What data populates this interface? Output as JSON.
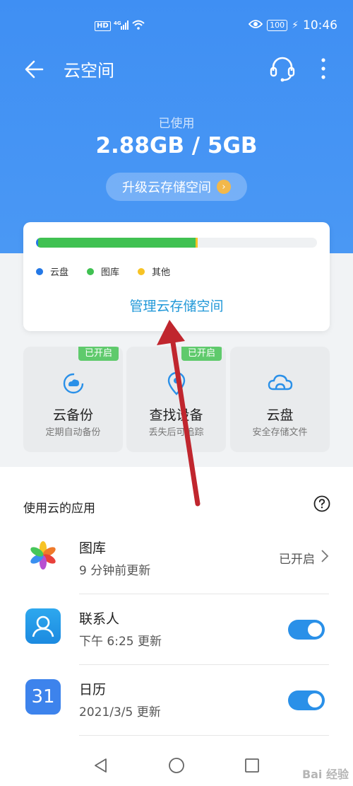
{
  "status_bar": {
    "network": "HD 4G",
    "time": "10:46",
    "battery": "100",
    "icons": [
      "hd-icon",
      "signal-icon",
      "wifi-icon",
      "eye-icon",
      "battery-icon",
      "charging-icon"
    ]
  },
  "header": {
    "title": "云空间",
    "back_icon": "back-arrow-icon",
    "support_icon": "headset-icon",
    "more_icon": "more-vertical-icon"
  },
  "usage": {
    "label": "已使用",
    "value": "2.88GB / 5GB",
    "used_fraction": 0.576,
    "upgrade_label": "升级云存储空间",
    "upgrade_icon": "chevron-right-icon"
  },
  "storage_card": {
    "segments": [
      {
        "name": "云盘",
        "fraction": 0.005,
        "color": "#2478e6"
      },
      {
        "name": "图库",
        "fraction": 0.56,
        "color": "#40c152"
      },
      {
        "name": "其他",
        "fraction": 0.008,
        "color": "#f7c325"
      }
    ],
    "legend": [
      {
        "label": "云盘",
        "color": "#2478e6"
      },
      {
        "label": "图库",
        "color": "#40c152"
      },
      {
        "label": "其他",
        "color": "#f7c325"
      }
    ],
    "manage_label": "管理云存储空间"
  },
  "tiles": [
    {
      "name": "云备份",
      "subtitle": "定期自动备份",
      "badge": "已开启",
      "icon": "cloud-backup-icon"
    },
    {
      "name": "查找设备",
      "subtitle": "丢失后可追踪",
      "badge": "已开启",
      "icon": "location-pin-icon"
    },
    {
      "name": "云盘",
      "subtitle": "安全存储文件",
      "badge": "",
      "icon": "cloud-icon"
    }
  ],
  "apps": {
    "header": "使用云的应用",
    "help_icon": "help-circle-icon",
    "items": [
      {
        "name": "图库",
        "updated": "9 分钟前更新",
        "status": "已开启",
        "icon": "gallery-icon",
        "toggle": null
      },
      {
        "name": "联系人",
        "updated": "下午 6:25 更新",
        "status": "",
        "icon": "contacts-icon",
        "toggle": true
      },
      {
        "name": "日历",
        "updated": "2021/3/5 更新",
        "status": "",
        "icon": "calendar-icon",
        "icon_text": "31",
        "toggle": true
      }
    ]
  },
  "nav_bar": {
    "icons": [
      "nav-back-icon",
      "nav-home-icon",
      "nav-recents-icon"
    ]
  },
  "watermark": "Bai 经验",
  "colors": {
    "header_blue": "#4090f3",
    "accent_blue": "#2198d8",
    "toggle_on": "#2a90e8",
    "badge_green": "#5fca6c",
    "annotation_arrow": "#c0262e"
  }
}
